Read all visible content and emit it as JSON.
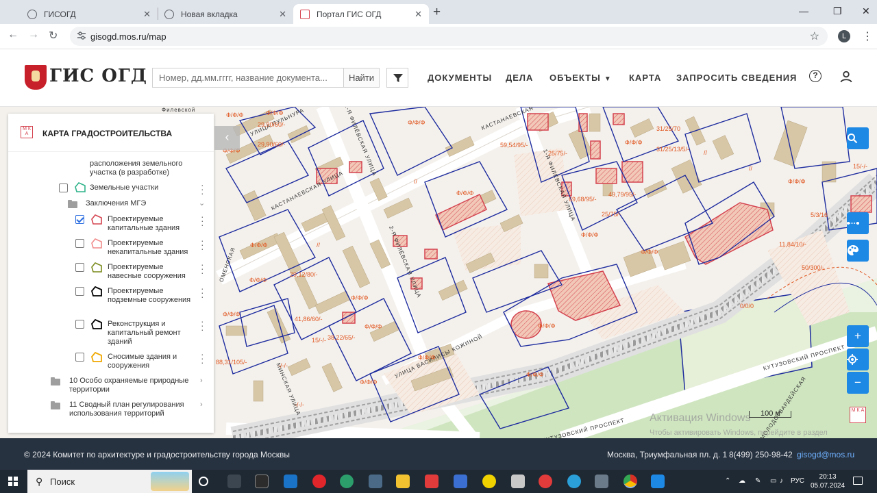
{
  "browser": {
    "tabs": [
      {
        "title": "ГИСОГД",
        "active": false
      },
      {
        "title": "Новая вкладка",
        "active": false
      },
      {
        "title": "Портал ГИС ОГД",
        "active": true
      }
    ],
    "url": "gisogd.mos.ru/map",
    "profile_initial": "L"
  },
  "site": {
    "logo_text": "ГИС ОГД",
    "search_placeholder": "Номер, дд.мм.гггг, название документа...",
    "search_button": "Найти",
    "nav": [
      "ДОКУМЕНТЫ",
      "ДЕЛА",
      "ОБЪЕКТЫ",
      "КАРТА",
      "ЗАПРОСИТЬ СВЕДЕНИЯ"
    ],
    "help_glyph": "?"
  },
  "panel": {
    "title": "КАРТА ГРАДОСТРОИТЕЛЬСТВА",
    "logo_text": "М К А",
    "partial_item": "расположения земельного участка (в разработке)",
    "items": [
      {
        "label": "Земельные участки",
        "checked": false,
        "icon_color": "#2fb38a"
      },
      {
        "label": "Заключения МГЭ",
        "folder": true
      },
      {
        "label": "Проектируемые капитальные здания",
        "checked": true,
        "icon_color": "#d4434f"
      },
      {
        "label": "Проектируемые некапитальные здания",
        "checked": false,
        "icon_color": "#f08a8a"
      },
      {
        "label": "Проектируемые навесные сооружения",
        "checked": false,
        "icon_color": "#7a8a1a"
      },
      {
        "label": "Проектируемые подземные сооружения",
        "checked": false,
        "icon_color": "#000000"
      },
      {
        "label": "Реконструкция и капитальный ремонт зданий",
        "checked": false,
        "icon_color": "#000000"
      },
      {
        "label": "Сносимые здания и сооружения",
        "checked": false,
        "icon_color": "#f0a800"
      }
    ],
    "groups": [
      "10 Особо охраняемые природные территории",
      "11 Сводный план регулирования использования территорий"
    ]
  },
  "map": {
    "streets": [
      "КАСТАНАЕВСКАЯ УЛИЦА",
      "2-Я ФИЛЁВСКАЯ УЛИЦА",
      "2-Я ФИЛЁВСКАЯ УЛИЦА",
      "УЛИЦА ВАСИЛИСЫ КОЖИНОЙ",
      "КУТУЗОВСКИЙ ПРОСПЕКТ",
      "КУТУЗОВСКИЙ ПРОСПЕКТ",
      "УЛИЦА МОЛОДОГВАРДЕЙСКАЯ",
      "1-Я ФИЛЁВСКАЯ УЛИЦА",
      "УЛИЦА ПУЛЬНУРА",
      "КАСТАНАЕВСКАЯ",
      "Филевской",
      "МИНСКАЯ УЛИЦА",
      "ОМЕНСКАЯ"
    ],
    "labels": [
      "29,90/60/-",
      "29,90/60/-",
      "Ф/Ф/Ф",
      "Ф/Ф/Ф",
      "Ф/Ф/Ф",
      "Ф/Ф/Ф",
      "59,54/95/-",
      "25/75/-",
      "69,68/95/-",
      "49,79/95/-",
      "25/75/-",
      "31/25/70",
      "31/25/13/5/-",
      "15/-/-",
      "5/3/16",
      "11,84/10/-",
      "50/300/-",
      "0/0/0",
      "29,12/80/-",
      "41,86/60/-",
      "38,22/65/-",
      "15/-/-",
      "88,31/105/-",
      "Ф/Ф/Ф",
      "Ф/Ф/Ф",
      "Ф/Ф/Ф",
      "Ф/Ф/Ф",
      "Ф/Ф/Ф",
      "Ф/Ф/Ф",
      "Ф/Ф/Ф",
      "Ф/Ф/Ф",
      "Ф/Ф/Ф",
      "Ф/Ф/Ф",
      "Ф/Ф/Ф",
      "Ф/Ф/Ф",
      "Ф/Ф/Ф",
      "Ф/Ф/Ф",
      "-/-/-",
      "-/-/-",
      "//",
      "//",
      "//",
      "//"
    ],
    "scale": "100 м",
    "watermark_title": "Активация Windows",
    "watermark_text": "Чтобы активировать Windows, перейдите в раздел \"Параметры\".",
    "corner_logo": "М К А"
  },
  "footer": {
    "copyright": "© 2024 Комитет по архитектуре и градостроительству города Москвы",
    "address": "Москва, Триумфальная пл. д. 1",
    "phone": "8(499) 250-98-42",
    "email": "gisogd@mos.ru"
  },
  "taskbar": {
    "search": "Поиск",
    "lang": "РУС",
    "time": "20:13",
    "date": "05.07.2024"
  },
  "colors": {
    "accent": "#1e88e5",
    "footer_bg": "#273240",
    "parcel_line": "#1f2d9e",
    "project_building": "#d4434f",
    "label": "#e0561f"
  }
}
